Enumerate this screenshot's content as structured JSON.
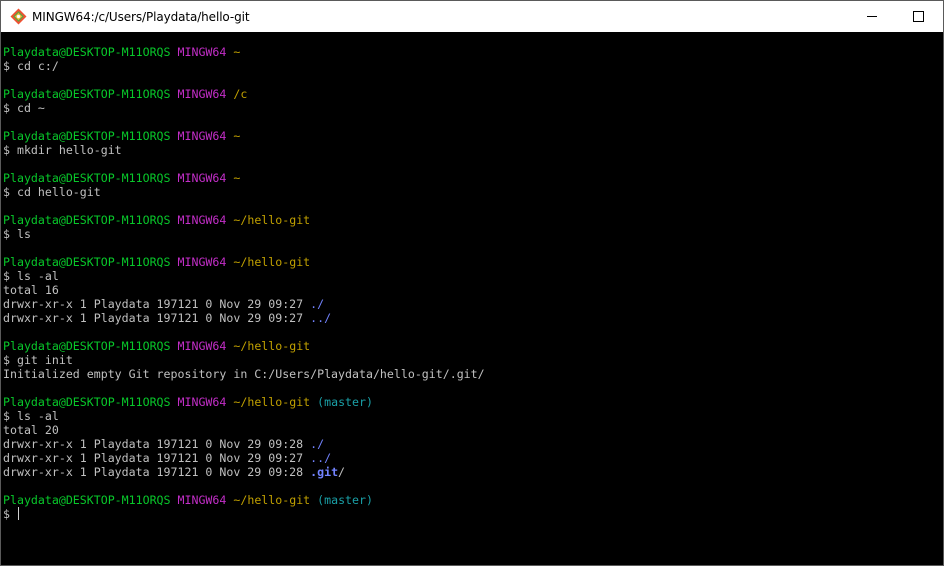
{
  "window": {
    "title": "MINGW64:/c/Users/Playdata/hello-git",
    "icon": "git-bash-icon",
    "controls": [
      "minimize-icon",
      "maximize-icon"
    ]
  },
  "colors": {
    "user_host": "#08c82a",
    "system": "#c32ec8",
    "path": "#c0a000",
    "branch": "#1aa0a7",
    "directory": "#7283ff",
    "text": "#c0c0c0",
    "background": "#000000"
  },
  "terminal": {
    "blocks": [
      {
        "prompt": {
          "user_host": "Playdata@DESKTOP-M11ORQS",
          "system": "MINGW64",
          "path": "~",
          "branch": ""
        },
        "command": "$ cd c:/",
        "output": []
      },
      {
        "prompt": {
          "user_host": "Playdata@DESKTOP-M11ORQS",
          "system": "MINGW64",
          "path": "/c",
          "branch": ""
        },
        "command": "$ cd ~",
        "output": []
      },
      {
        "prompt": {
          "user_host": "Playdata@DESKTOP-M11ORQS",
          "system": "MINGW64",
          "path": "~",
          "branch": ""
        },
        "command": "$ mkdir hello-git",
        "output": []
      },
      {
        "prompt": {
          "user_host": "Playdata@DESKTOP-M11ORQS",
          "system": "MINGW64",
          "path": "~",
          "branch": ""
        },
        "command": "$ cd hello-git",
        "output": []
      },
      {
        "prompt": {
          "user_host": "Playdata@DESKTOP-M11ORQS",
          "system": "MINGW64",
          "path": "~/hello-git",
          "branch": ""
        },
        "command": "$ ls",
        "output": []
      },
      {
        "prompt": {
          "user_host": "Playdata@DESKTOP-M11ORQS",
          "system": "MINGW64",
          "path": "~/hello-git",
          "branch": ""
        },
        "command": "$ ls -al",
        "output": [
          {
            "text": "total 16",
            "entry": "",
            "kind": ""
          },
          {
            "text": "drwxr-xr-x 1 Playdata 197121 0 Nov 29 09:27 ",
            "entry": "./",
            "kind": "dir"
          },
          {
            "text": "drwxr-xr-x 1 Playdata 197121 0 Nov 29 09:27 ",
            "entry": "../",
            "kind": "dir"
          }
        ]
      },
      {
        "prompt": {
          "user_host": "Playdata@DESKTOP-M11ORQS",
          "system": "MINGW64",
          "path": "~/hello-git",
          "branch": ""
        },
        "command": "$ git init",
        "output": [
          {
            "text": "Initialized empty Git repository in C:/Users/Playdata/hello-git/.git/",
            "entry": "",
            "kind": ""
          }
        ]
      },
      {
        "prompt": {
          "user_host": "Playdata@DESKTOP-M11ORQS",
          "system": "MINGW64",
          "path": "~/hello-git",
          "branch": "(master)"
        },
        "command": "$ ls -al",
        "output": [
          {
            "text": "total 20",
            "entry": "",
            "kind": ""
          },
          {
            "text": "drwxr-xr-x 1 Playdata 197121 0 Nov 29 09:28 ",
            "entry": "./",
            "kind": "dir"
          },
          {
            "text": "drwxr-xr-x 1 Playdata 197121 0 Nov 29 09:27 ",
            "entry": "../",
            "kind": "dir"
          },
          {
            "text": "drwxr-xr-x 1 Playdata 197121 0 Nov 29 09:28 ",
            "entry": ".git",
            "kind": "git",
            "suffix": "/"
          }
        ]
      },
      {
        "prompt": {
          "user_host": "Playdata@DESKTOP-M11ORQS",
          "system": "MINGW64",
          "path": "~/hello-git",
          "branch": "(master)"
        },
        "command": "$ ",
        "cursor": true,
        "output": []
      }
    ]
  }
}
